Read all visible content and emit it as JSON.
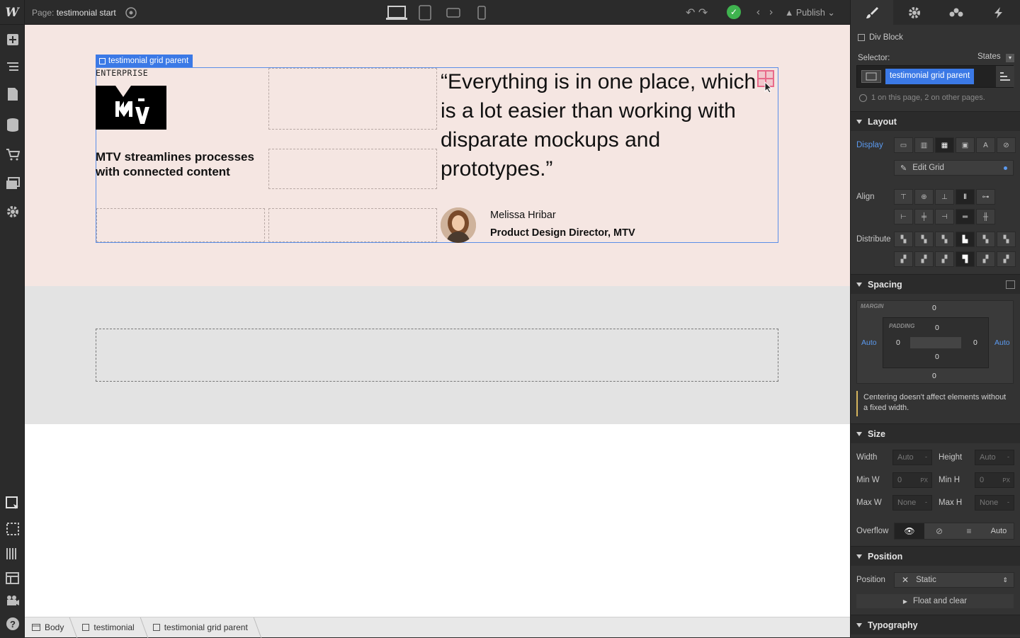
{
  "topbar": {
    "logo": "W",
    "page_prefix": "Page:",
    "page_name": "testimonial start",
    "publish_label": "Publish"
  },
  "canvas": {
    "selection_label": "testimonial grid parent",
    "enterprise_label": "ENTERPRISE",
    "headline": "MTV streamlines processes with connected content",
    "quote": "“Everything is in one place, which is a lot easier than working with disparate mockups and prototypes.”",
    "person_name": "Melissa Hribar",
    "person_title": "Product Design Director, MTV"
  },
  "breadcrumb": [
    "Body",
    "testimonial",
    "testimonial grid parent"
  ],
  "panel": {
    "element_type": "Div Block",
    "selector_label": "Selector:",
    "states_label": "States",
    "selector_class": "testimonial grid parent",
    "usage_note": "1 on this page, 2 on other pages.",
    "layout": {
      "title": "Layout",
      "display_label": "Display",
      "edit_grid_label": "Edit Grid",
      "align_label": "Align",
      "distribute_label": "Distribute"
    },
    "spacing": {
      "title": "Spacing",
      "margin_label": "MARGIN",
      "padding_label": "PADDING",
      "margin_top": "0",
      "margin_bottom": "0",
      "margin_left": "Auto",
      "margin_right": "Auto",
      "padding_top": "0",
      "padding_bottom": "0",
      "padding_left": "0",
      "padding_right": "0",
      "note": "Centering doesn't affect elements without a fixed width."
    },
    "size": {
      "title": "Size",
      "width_label": "Width",
      "width_value": "Auto",
      "height_label": "Height",
      "height_value": "Auto",
      "minw_label": "Min W",
      "minw_value": "0",
      "minh_label": "Min H",
      "minh_value": "0",
      "maxw_label": "Max W",
      "maxw_value": "None",
      "maxh_label": "Max H",
      "maxh_value": "None",
      "unit_px": "PX",
      "unit_dash": "-",
      "overflow_label": "Overflow",
      "overflow_auto": "Auto"
    },
    "position": {
      "title": "Position",
      "position_label": "Position",
      "position_value": "Static",
      "float_label": "Float and clear"
    },
    "typography": {
      "title": "Typography"
    }
  },
  "colors": {
    "selection_blue": "#3b79e6",
    "canvas_pink": "#f5e6e2",
    "canvas_gray": "#e3e3e3",
    "status_green": "#3fb34f"
  }
}
